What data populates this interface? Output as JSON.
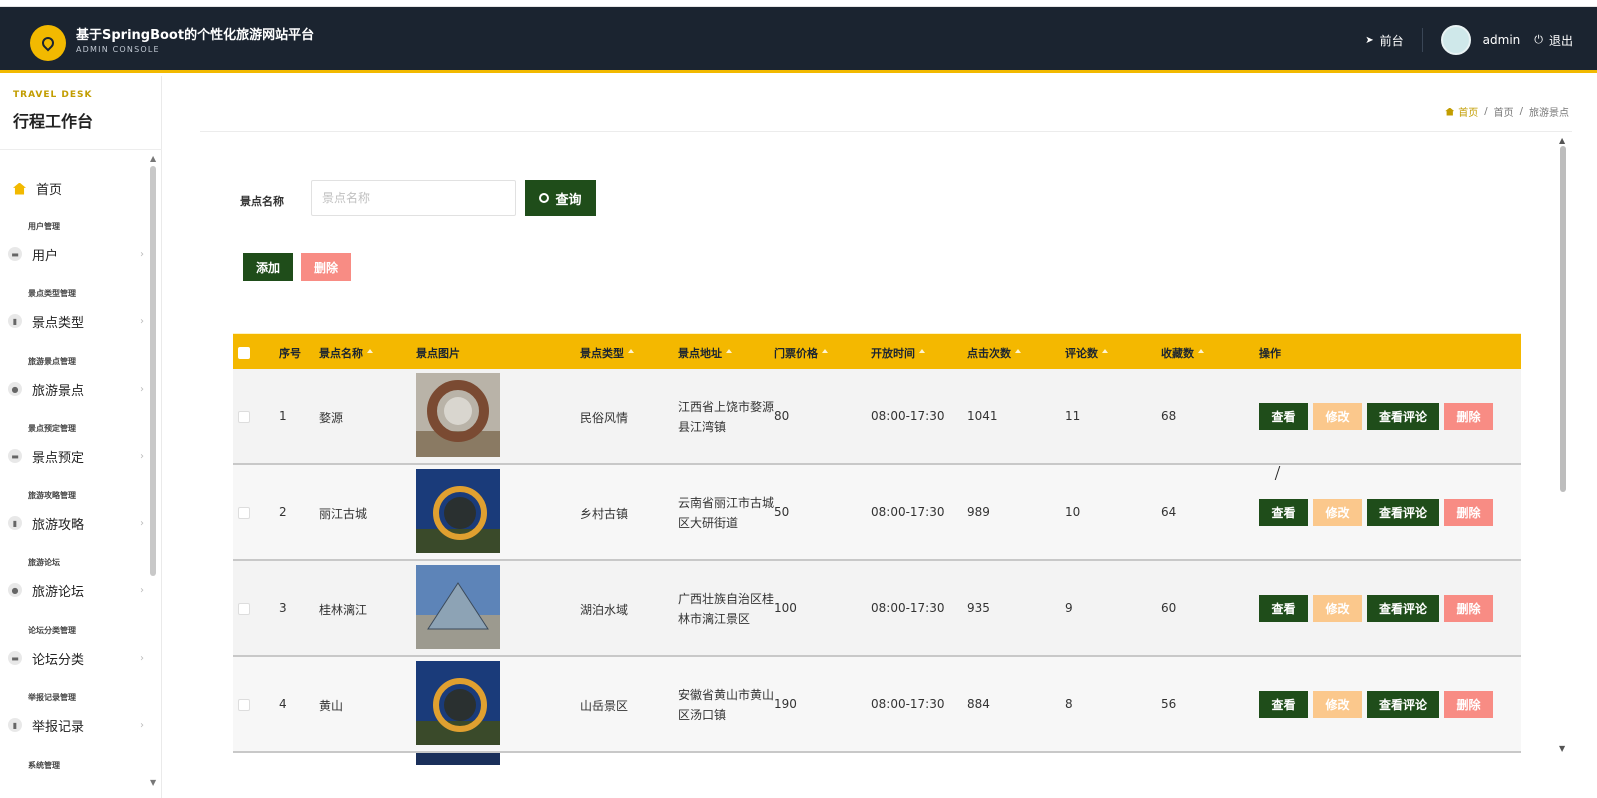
{
  "header": {
    "title": "基于SpringBoot的个性化旅游网站平台",
    "subtitle": "ADMIN CONSOLE",
    "front_label": "前台",
    "user_name": "admin",
    "logout_label": "退出"
  },
  "sidebar": {
    "tag": "TRAVEL DESK",
    "title": "行程工作台",
    "home_label": "首页",
    "groups": [
      {
        "group_label": "用户管理",
        "item_label": "用户"
      },
      {
        "group_label": "景点类型管理",
        "item_label": "景点类型"
      },
      {
        "group_label": "旅游景点管理",
        "item_label": "旅游景点"
      },
      {
        "group_label": "景点预定管理",
        "item_label": "景点预定"
      },
      {
        "group_label": "旅游攻略管理",
        "item_label": "旅游攻略"
      },
      {
        "group_label": "旅游论坛",
        "item_label": "旅游论坛"
      },
      {
        "group_label": "论坛分类管理",
        "item_label": "论坛分类"
      },
      {
        "group_label": "举报记录管理",
        "item_label": "举报记录"
      },
      {
        "group_label": "系统管理",
        "item_label": ""
      }
    ]
  },
  "breadcrumb": [
    "首页",
    "首页",
    "旅游景点"
  ],
  "search": {
    "label": "景点名称",
    "placeholder": "景点名称",
    "button_label": "查询"
  },
  "toolbar": {
    "add_label": "添加",
    "delete_label": "删除"
  },
  "table": {
    "columns": [
      "序号",
      "景点名称",
      "景点图片",
      "景点类型",
      "景点地址",
      "门票价格",
      "开放时间",
      "点击次数",
      "评论数",
      "收藏数",
      "操作"
    ],
    "actions": {
      "view": "查看",
      "edit": "修改",
      "comments": "查看评论",
      "delete": "删除"
    },
    "rows": [
      {
        "index": "1",
        "name": "婺源",
        "type": "民俗风情",
        "address": "江西省上饶市婺源县江湾镇",
        "price": "80",
        "hours": "08:00-17:30",
        "clicks": "1041",
        "comments": "11",
        "favorites": "68"
      },
      {
        "index": "2",
        "name": "丽江古城",
        "type": "乡村古镇",
        "address": "云南省丽江市古城区大研街道",
        "price": "50",
        "hours": "08:00-17:30",
        "clicks": "989",
        "comments": "10",
        "favorites": "64"
      },
      {
        "index": "3",
        "name": "桂林漓江",
        "type": "湖泊水域",
        "address": "广西壮族自治区桂林市漓江景区",
        "price": "100",
        "hours": "08:00-17:30",
        "clicks": "935",
        "comments": "9",
        "favorites": "60"
      },
      {
        "index": "4",
        "name": "黄山",
        "type": "山岳景区",
        "address": "安徽省黄山市黄山区汤口镇",
        "price": "190",
        "hours": "08:00-17:30",
        "clicks": "884",
        "comments": "8",
        "favorites": "56"
      }
    ]
  },
  "colors": {
    "header_bg": "#1b2430",
    "accent": "#f4b800",
    "primary_button": "#1f4d1a",
    "danger_button": "#f88c84",
    "edit_button": "#fbc88c"
  }
}
